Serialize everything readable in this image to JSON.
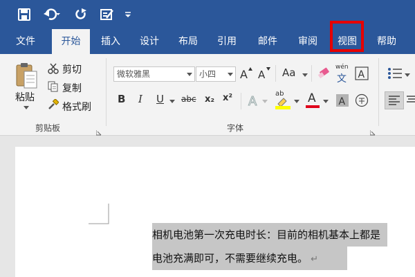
{
  "quick_access": {
    "icons": [
      "save-icon",
      "undo-icon",
      "redo-icon",
      "touch-mode-icon",
      "customize-qat-icon"
    ]
  },
  "tabs": [
    {
      "label": "文件"
    },
    {
      "label": "开始"
    },
    {
      "label": "插入"
    },
    {
      "label": "设计"
    },
    {
      "label": "布局"
    },
    {
      "label": "引用"
    },
    {
      "label": "邮件"
    },
    {
      "label": "审阅"
    },
    {
      "label": "视图"
    },
    {
      "label": "帮助"
    }
  ],
  "active_tab": "开始",
  "highlighted_tab": "视图",
  "clipboard": {
    "paste_label": "粘贴",
    "cut_label": "剪切",
    "copy_label": "复制",
    "format_painter_label": "格式刷",
    "group_label": "剪贴板"
  },
  "font": {
    "font_name": "微软雅黑",
    "font_size": "小四",
    "group_label": "字体",
    "change_case_label": "Aa",
    "bold": "B",
    "italic": "I",
    "underline": "U",
    "strikethrough": "abc",
    "subscript": "x₂",
    "superscript": "x²",
    "phonetic_top": "wén",
    "phonetic_bottom": "文",
    "highlight_label": "ab",
    "font_color_label": "A"
  },
  "colors": {
    "title_bar": "#2b579a",
    "ribbon_bg": "#f3f3f3",
    "highlight_box": "#e60000",
    "selection_bg": "#c6c6c6",
    "font_color_underline": "#e0001b",
    "text_highlight_yellow": "#ffff00"
  },
  "document": {
    "line1": "相机电池第一次充电时长：目前的相机基本上都是",
    "line2": "电池充满即可，不需要继续充电。"
  }
}
